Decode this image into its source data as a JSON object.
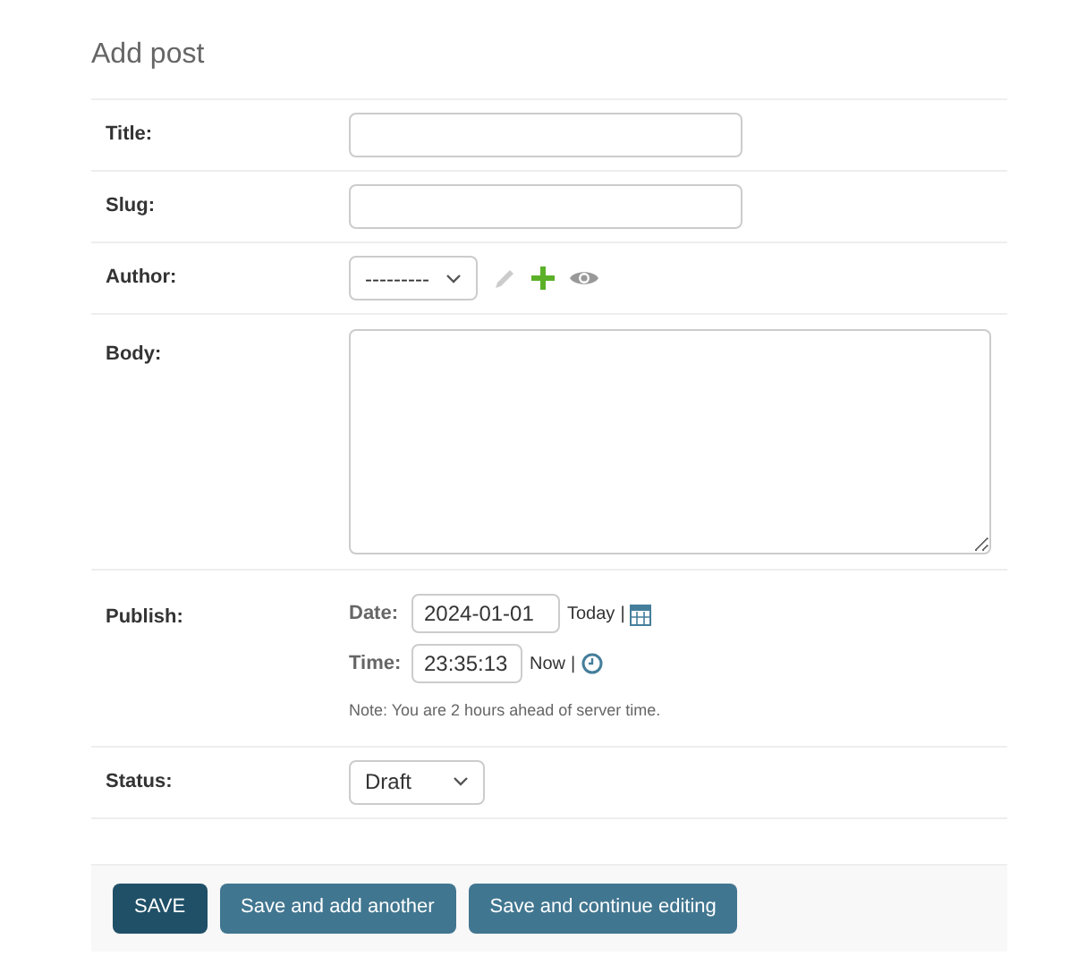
{
  "heading": "Add post",
  "fields": [
    {
      "kind": "text",
      "label": "Title:"
    },
    {
      "kind": "text",
      "label": "Slug:"
    },
    {
      "kind": "fk",
      "label": "Author:",
      "value": "---------"
    },
    {
      "kind": "textarea",
      "label": "Body:"
    },
    {
      "kind": "datetime",
      "label": "Publish:",
      "date_label": "Date:",
      "date": "2024-01-01",
      "today": "Today",
      "sep1": "|",
      "time_label": "Time:",
      "time": "23:35:13",
      "now": "Now",
      "sep2": "|",
      "note": "Note: You are 2 hours ahead of server time."
    },
    {
      "kind": "select",
      "label": "Status:",
      "value": "Draft"
    }
  ],
  "buttons": [
    {
      "label": "SAVE",
      "kind": "default"
    },
    {
      "label": "Save and add another",
      "kind": "secondary"
    },
    {
      "label": "Save and continue editing",
      "kind": "secondary"
    }
  ]
}
